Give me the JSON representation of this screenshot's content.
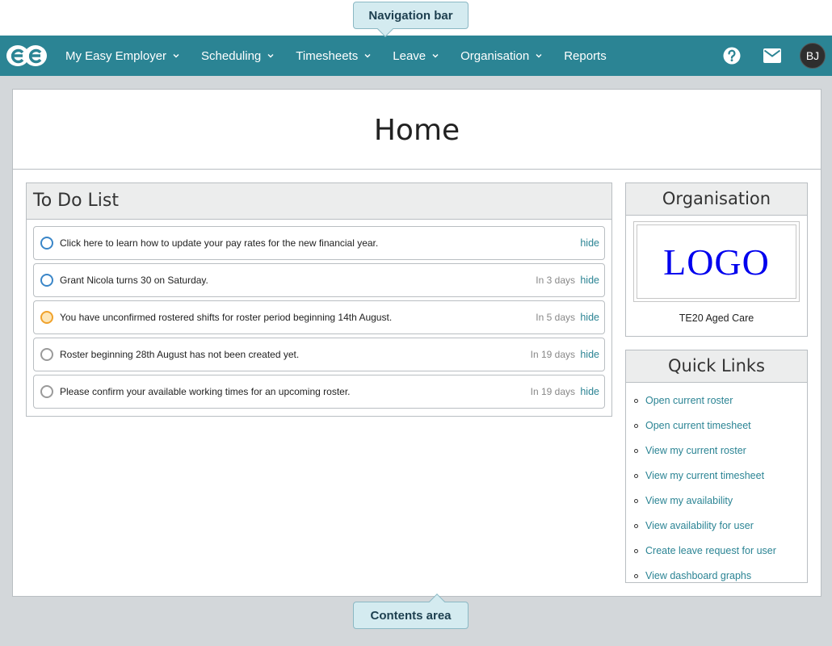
{
  "callouts": {
    "navigation": "Navigation bar",
    "contents": "Contents area"
  },
  "nav": {
    "items": [
      {
        "label": "My Easy Employer",
        "dropdown": true
      },
      {
        "label": "Scheduling",
        "dropdown": true
      },
      {
        "label": "Timesheets",
        "dropdown": true
      },
      {
        "label": "Leave",
        "dropdown": true
      },
      {
        "label": "Organisation",
        "dropdown": true
      },
      {
        "label": "Reports",
        "dropdown": false
      }
    ],
    "avatar_initials": "BJ",
    "icons": {
      "logo": "ee-logo-icon",
      "help": "help-icon",
      "mail": "mail-icon"
    },
    "background": "#2b8494"
  },
  "page": {
    "title": "Home"
  },
  "todo": {
    "title": "To Do List",
    "items": [
      {
        "text": "Click here to learn how to update your pay rates for the new financial year.",
        "when": "",
        "hide": "hide",
        "status": "blue"
      },
      {
        "text": "Grant Nicola turns 30 on Saturday.",
        "when": "In 3 days",
        "hide": "hide",
        "status": "blue"
      },
      {
        "text": "You have unconfirmed rostered shifts for roster period beginning 14th August.",
        "when": "In 5 days",
        "hide": "hide",
        "status": "orange"
      },
      {
        "text": "Roster beginning 28th August has not been created yet.",
        "when": "In 19 days",
        "hide": "hide",
        "status": "grey"
      },
      {
        "text": "Please confirm your available working times for an upcoming roster.",
        "when": "In 19 days",
        "hide": "hide",
        "status": "grey"
      }
    ]
  },
  "organisation": {
    "title": "Organisation",
    "logo_text": "LOGO",
    "name": "TE20 Aged Care"
  },
  "quick_links": {
    "title": "Quick Links",
    "items": [
      "Open current roster",
      "Open current timesheet",
      "View my current roster",
      "View my current timesheet",
      "View my availability",
      "View availability for user",
      "Create leave request for user",
      "View dashboard graphs"
    ]
  },
  "colors": {
    "accent": "#2b8494",
    "status_blue": "#3a86c8",
    "status_orange": "#f0a22c",
    "status_grey": "#9a9a9a"
  }
}
